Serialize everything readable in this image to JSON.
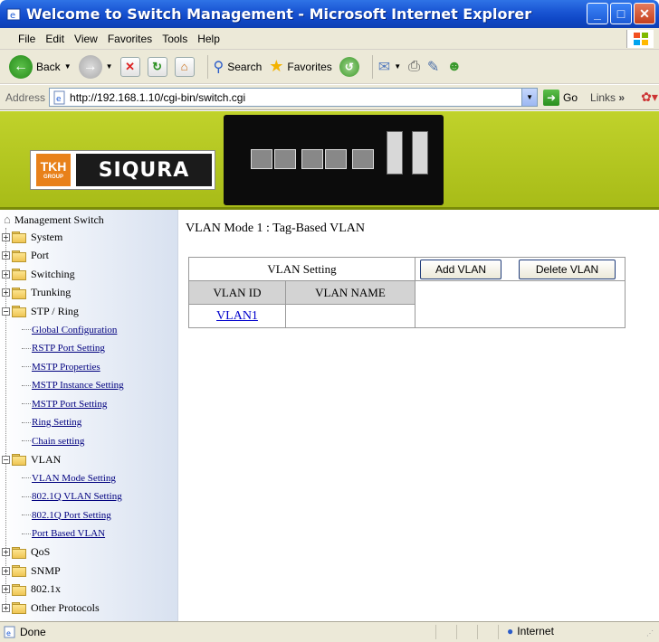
{
  "window": {
    "title": "Welcome to Switch Management - Microsoft Internet Explorer",
    "minimize": "_",
    "maximize": "□",
    "close": "✕"
  },
  "menu": [
    "File",
    "Edit",
    "View",
    "Favorites",
    "Tools",
    "Help"
  ],
  "toolbar": {
    "back": "Back",
    "search": "Search",
    "favorites": "Favorites"
  },
  "address": {
    "label": "Address",
    "url": "http://192.168.1.10/cgi-bin/switch.cgi",
    "go": "Go",
    "links": "Links"
  },
  "banner": {
    "brand_left": "TKH",
    "brand_left_sub": "GROUP",
    "brand_right": "SIQURA"
  },
  "sidebar": {
    "root": "Management Switch",
    "items": [
      {
        "label": "System",
        "type": "folder",
        "expander": "+"
      },
      {
        "label": "Port",
        "type": "folder",
        "expander": "+"
      },
      {
        "label": "Switching",
        "type": "folder",
        "expander": "+"
      },
      {
        "label": "Trunking",
        "type": "folder",
        "expander": "+"
      },
      {
        "label": "STP / Ring",
        "type": "folder-open",
        "expander": "−"
      },
      {
        "label": "Global Configuration",
        "type": "link"
      },
      {
        "label": "RSTP Port Setting",
        "type": "link"
      },
      {
        "label": "MSTP Properties",
        "type": "link"
      },
      {
        "label": "MSTP Instance Setting",
        "type": "link"
      },
      {
        "label": "MSTP Port Setting",
        "type": "link"
      },
      {
        "label": "Ring Setting",
        "type": "link"
      },
      {
        "label": "Chain setting",
        "type": "link"
      },
      {
        "label": "VLAN",
        "type": "folder-open",
        "expander": "−"
      },
      {
        "label": "VLAN Mode Setting",
        "type": "link"
      },
      {
        "label": "802.1Q VLAN Setting",
        "type": "link"
      },
      {
        "label": "802.1Q Port Setting",
        "type": "link"
      },
      {
        "label": "Port Based VLAN",
        "type": "link"
      },
      {
        "label": "QoS",
        "type": "folder",
        "expander": "+"
      },
      {
        "label": "SNMP",
        "type": "folder",
        "expander": "+"
      },
      {
        "label": "802.1x",
        "type": "folder",
        "expander": "+"
      },
      {
        "label": "Other Protocols",
        "type": "folder",
        "expander": "+"
      }
    ]
  },
  "main": {
    "mode_title": "VLAN Mode 1 : Tag-Based VLAN",
    "setting_label": "VLAN Setting",
    "add_button": "Add VLAN",
    "delete_button": "Delete VLAN",
    "columns": [
      "VLAN ID",
      "VLAN NAME"
    ],
    "rows": [
      {
        "id": "VLAN1",
        "name": ""
      }
    ]
  },
  "status": {
    "text": "Done",
    "zone": "Internet"
  }
}
